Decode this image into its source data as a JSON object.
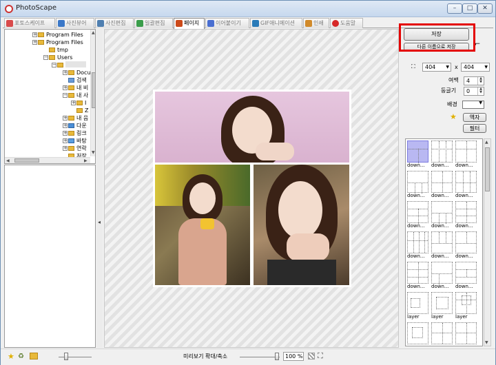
{
  "window": {
    "title": "PhotoScape",
    "min": "–",
    "max": "□",
    "close": "✕"
  },
  "tabs": [
    {
      "label": "포토스케이프",
      "color": "#d94b4b"
    },
    {
      "label": "사진뷰어",
      "color": "#3b78c8"
    },
    {
      "label": "사진편집",
      "color": "#4f7fb0"
    },
    {
      "label": "일괄편집",
      "color": "#3a9d4a"
    },
    {
      "label": "페이지",
      "color": "#cc4a1a"
    },
    {
      "label": "이어붙이기",
      "color": "#4a6fd1"
    },
    {
      "label": "GIF애니메이션",
      "color": "#2a7bb8"
    },
    {
      "label": "인쇄",
      "color": "#d18a2a"
    },
    {
      "label": "도움말",
      "color": "#d62828"
    }
  ],
  "tree": {
    "items": [
      "Program Files",
      "Program Files",
      "tmp",
      "Users",
      "",
      "Docu",
      "검색",
      "내 비",
      "내 사",
      "I",
      "Z",
      "내 음",
      "다운",
      "링크",
      "바탕",
      "연락",
      "저장"
    ]
  },
  "right": {
    "save_label": "저장",
    "save_as_label": "다른 이름으로 저장",
    "width_value": "404",
    "height_value": "404",
    "x_label": "x",
    "margin_label": "여백",
    "margin_value": "4",
    "round_label": "둥글기",
    "round_value": "0",
    "bg_label": "배경",
    "frame_label": "액자",
    "filter_label": "필터"
  },
  "templates": [
    {
      "label": "down..."
    },
    {
      "label": "down..."
    },
    {
      "label": "down..."
    },
    {
      "label": "down..."
    },
    {
      "label": "down..."
    },
    {
      "label": "down..."
    },
    {
      "label": "down..."
    },
    {
      "label": "down..."
    },
    {
      "label": "down..."
    },
    {
      "label": "down..."
    },
    {
      "label": "down..."
    },
    {
      "label": "down..."
    },
    {
      "label": "down..."
    },
    {
      "label": "down..."
    },
    {
      "label": "down..."
    },
    {
      "label": "layer"
    },
    {
      "label": "layer"
    },
    {
      "label": "layer"
    },
    {
      "label": ""
    },
    {
      "label": ""
    },
    {
      "label": ""
    }
  ],
  "status": {
    "preview_label": "미리보기 확대/축소",
    "zoom_value": "100 %"
  },
  "colors": {
    "highlight": "#e40000",
    "selected_template": "#b9b8f2",
    "photo_bg_top": "#e6c6de"
  }
}
